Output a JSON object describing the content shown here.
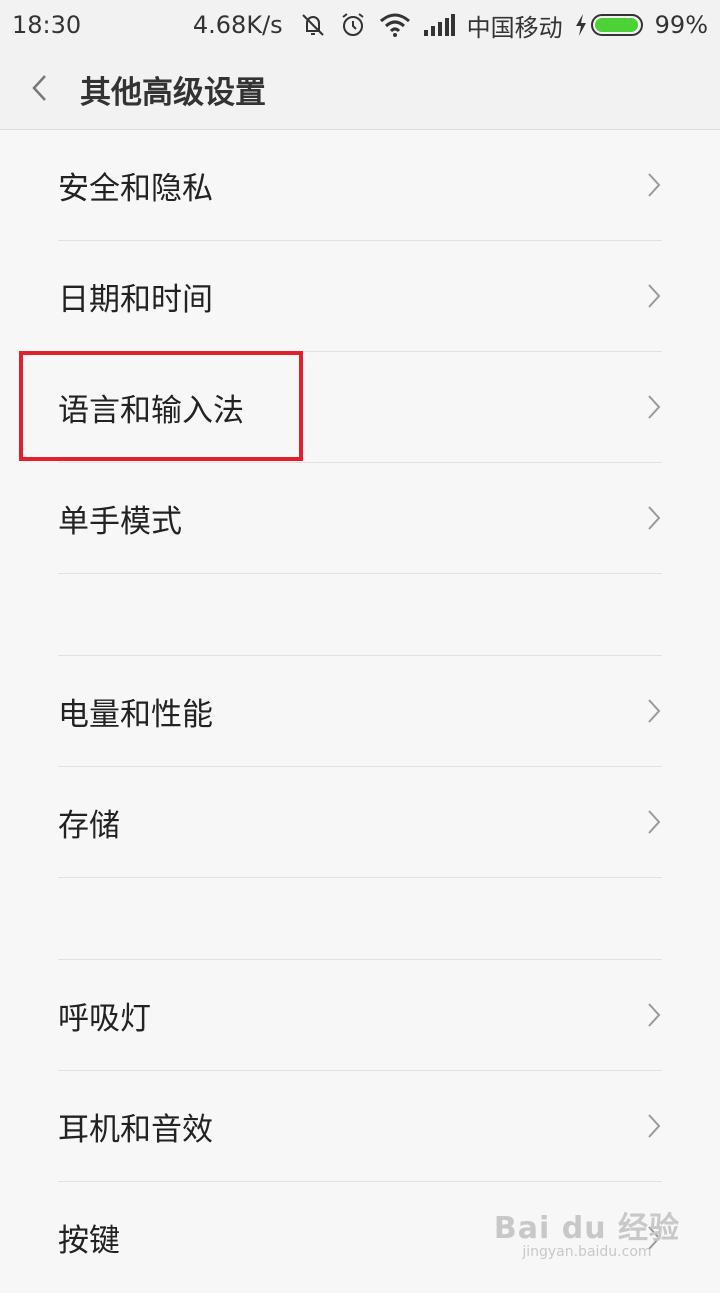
{
  "status_bar": {
    "time": "18:30",
    "net_speed": "4.68K/s",
    "carrier": "中国移动",
    "battery_percent": "99%",
    "battery_level": 0.99,
    "icons": [
      "mute-vibrate-icon",
      "alarm-icon",
      "wifi-icon",
      "signal-icon",
      "charging-icon",
      "battery-icon"
    ]
  },
  "header": {
    "title": "其他高级设置",
    "back_icon": "chevron-left-icon"
  },
  "groups": [
    {
      "items": [
        {
          "label": "安全和隐私"
        },
        {
          "label": "日期和时间"
        },
        {
          "label": "语言和输入法",
          "highlighted": true
        },
        {
          "label": "单手模式"
        }
      ]
    },
    {
      "items": [
        {
          "label": "电量和性能"
        },
        {
          "label": "存储"
        }
      ]
    },
    {
      "items": [
        {
          "label": "呼吸灯"
        },
        {
          "label": "耳机和音效"
        },
        {
          "label": "按键"
        }
      ]
    }
  ],
  "colors": {
    "highlight_border": "#e0202a",
    "battery_fill": "#4cd137",
    "background": "#f7f7f7"
  },
  "watermark": {
    "main": "Bai du 经验",
    "sub": "jingyan.baidu.com"
  }
}
